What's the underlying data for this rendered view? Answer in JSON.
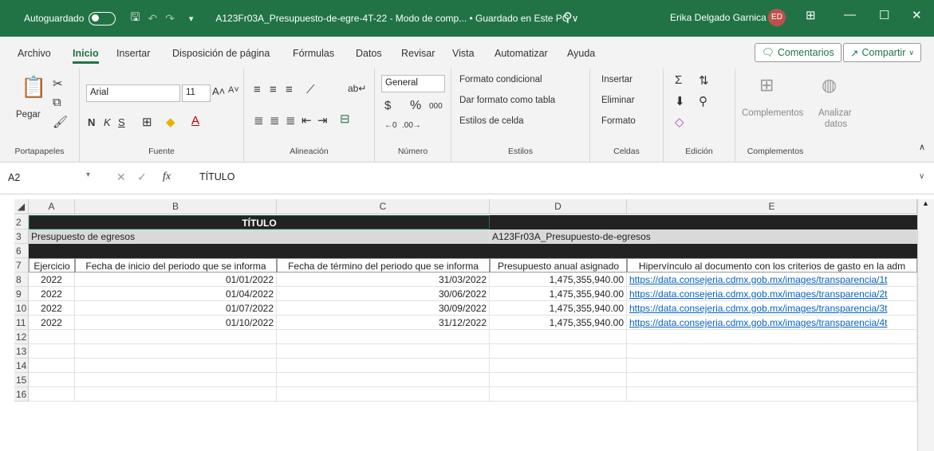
{
  "titlebar": {
    "autosave_label": "Autoguardado",
    "doc_title": "A123Fr03A_Presupuesto-de-egre-4T-22  -  Modo de comp...  • Guardado en Este PC ∨",
    "user": "Erika Delgado Garnica",
    "avatar": "ED"
  },
  "tabs": [
    "Archivo",
    "Inicio",
    "Insertar",
    "Disposición de página",
    "Fórmulas",
    "Datos",
    "Revisar",
    "Vista",
    "Automatizar",
    "Ayuda"
  ],
  "actions": {
    "comments": "Comentarios",
    "share": "Compartir"
  },
  "ribbon": {
    "clipboard": {
      "paste": "Pegar",
      "label": "Portapapeles"
    },
    "font": {
      "name": "Arial",
      "size": "11",
      "bold": "N",
      "italic": "K",
      "underline": "S",
      "label": "Fuente"
    },
    "alignment": {
      "label": "Alineación"
    },
    "number": {
      "format": "General",
      "percent": "%",
      "thousands": "000",
      "label": "Número"
    },
    "styles": {
      "conditional": "Formato condicional",
      "table": "Dar formato como tabla",
      "cell": "Estilos de celda",
      "label": "Estilos"
    },
    "cells": {
      "insert": "Insertar",
      "delete": "Eliminar",
      "format": "Formato",
      "label": "Celdas"
    },
    "editing": {
      "label": "Edición"
    },
    "addins": {
      "addins": "Complementos",
      "analyze": "Analizar",
      "analyze2": "datos",
      "label": "Complementos"
    }
  },
  "formula": {
    "namebox": "A2",
    "value": "TÍTULO"
  },
  "columns": [
    "A",
    "B",
    "C",
    "D",
    "E"
  ],
  "sheet": {
    "title": "TÍTULO",
    "row3_a": "Presupuesto de egresos",
    "row3_d": "A123Fr03A_Presupuesto-de-egresos",
    "headers": [
      "Ejercicio",
      "Fecha de inicio del periodo que se informa",
      "Fecha de término del periodo que se informa",
      "Presupuesto anual asignado",
      "Hipervínculo al documento con los criterios de gasto en la adm"
    ],
    "rows": [
      {
        "n": "8",
        "year": "2022",
        "start": "01/01/2022",
        "end": "31/03/2022",
        "amount": "1,475,355,940.00",
        "link": "https://data.consejeria.cdmx.gob.mx/images/transparencia/1t"
      },
      {
        "n": "9",
        "year": "2022",
        "start": "01/04/2022",
        "end": "30/06/2022",
        "amount": "1,475,355,940.00",
        "link": "https://data.consejeria.cdmx.gob.mx/images/transparencia/2t"
      },
      {
        "n": "10",
        "year": "2022",
        "start": "01/07/2022",
        "end": "30/09/2022",
        "amount": "1,475,355,940.00",
        "link": "https://data.consejeria.cdmx.gob.mx/images/transparencia/3t"
      },
      {
        "n": "11",
        "year": "2022",
        "start": "01/10/2022",
        "end": "31/12/2022",
        "amount": "1,475,355,940.00",
        "link": "https://data.consejeria.cdmx.gob.mx/images/transparencia/4t"
      }
    ],
    "row_numbers": [
      "2",
      "3",
      "6",
      "7",
      "8",
      "9",
      "10",
      "11",
      "12",
      "13",
      "14",
      "15",
      "16"
    ]
  }
}
